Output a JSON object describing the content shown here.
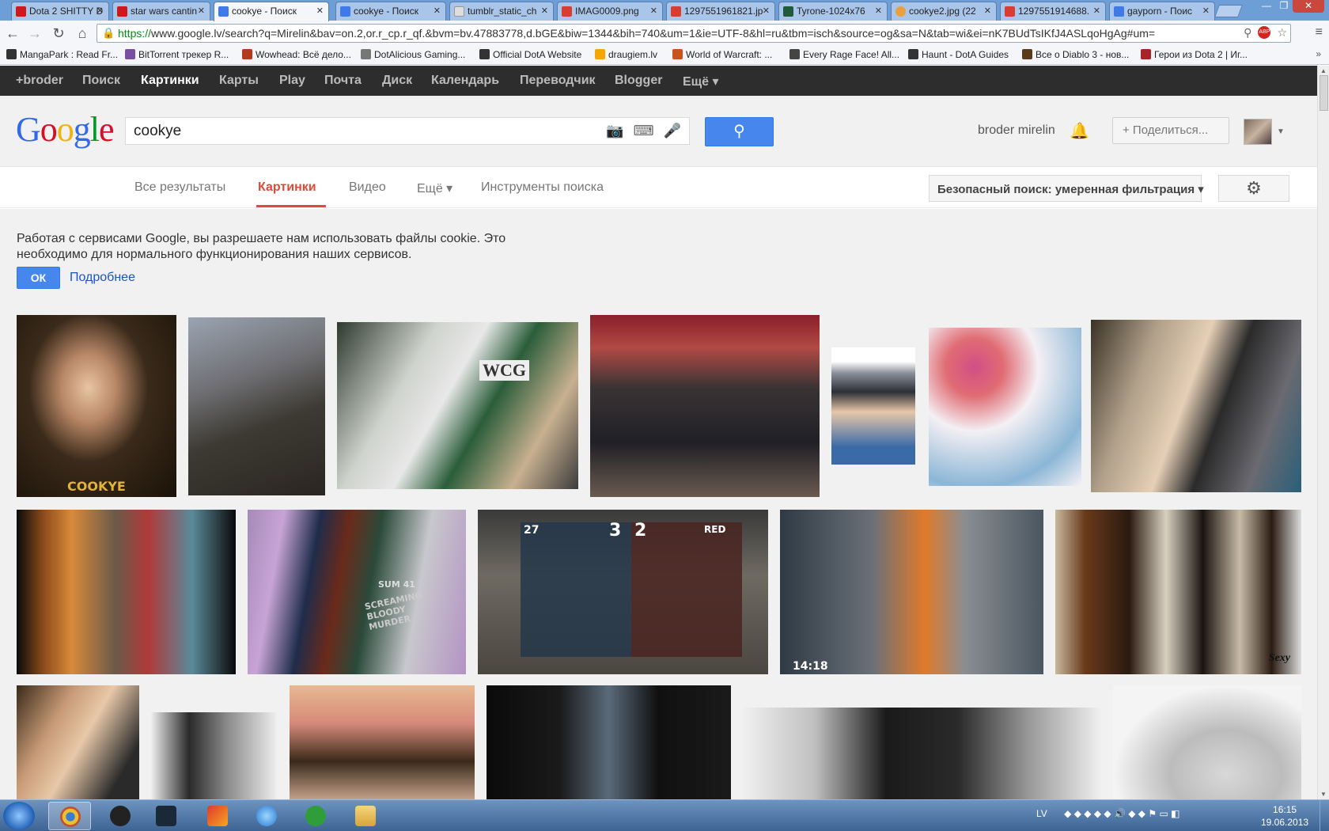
{
  "browser": {
    "tabs": [
      {
        "label": "Dota 2 SHITTY D",
        "color": "#cc181e"
      },
      {
        "label": "star wars cantin",
        "color": "#cc181e"
      },
      {
        "label": "cookye - Поиск",
        "color": "#3f7ae8"
      },
      {
        "label": "cookye - Поиск",
        "color": "#3f7ae8"
      },
      {
        "label": "tumblr_static_ch",
        "color": "#999999"
      },
      {
        "label": "IMAG0009.png",
        "color": "#d73d32"
      },
      {
        "label": "1297551961821.jp",
        "color": "#d73d32"
      },
      {
        "label": "Tyrone-1024x76",
        "color": "#1f5a3a"
      },
      {
        "label": "cookye2.jpg (22",
        "color": "#e8a13f"
      },
      {
        "label": "1297551914688.",
        "color": "#d73d32"
      },
      {
        "label": "gayporn - Поис",
        "color": "#3f7ae8"
      }
    ],
    "url_https": "https://",
    "url_rest": "www.google.lv/search?q=Mirelin&bav=on.2,or.r_cp.r_qf.&bvm=bv.47883778,d.bGE&biw=1344&bih=740&um=1&ie=UTF-8&hl=ru&tbm=isch&source=og&sa=N&tab=wi&ei=nK7BUdTsIKfJ4ASLqoHgAg#um=",
    "abp_label": "ABP",
    "bookmarks": [
      {
        "label": "MangaPark : Read Fr...",
        "color": "#333333"
      },
      {
        "label": "BitTorrent трекер R...",
        "color": "#7a4ea0"
      },
      {
        "label": "Wowhead: Всё дело...",
        "color": "#b33a1d"
      },
      {
        "label": "DotAlicious Gaming...",
        "color": "#777777"
      },
      {
        "label": "Official DotA Website",
        "color": "#333333"
      },
      {
        "label": "draugiem.lv",
        "color": "#f5a700"
      },
      {
        "label": "World of Warcraft: ...",
        "color": "#c9531e"
      },
      {
        "label": "Every Rage Face! All...",
        "color": "#444444"
      },
      {
        "label": "Haunt - DotA Guides",
        "color": "#333333"
      },
      {
        "label": "Все о Diablo 3 - нов...",
        "color": "#5a3a1a"
      },
      {
        "label": "Герои из Dota 2 | Иг...",
        "color": "#a5252a"
      }
    ]
  },
  "google": {
    "bar": [
      "+broder",
      "Поиск",
      "Картинки",
      "Карты",
      "Play",
      "Почта",
      "Диск",
      "Календарь",
      "Переводчик",
      "Blogger",
      "Ещё ▾"
    ],
    "logo": [
      "G",
      "o",
      "o",
      "g",
      "l",
      "e"
    ],
    "query": "cookye",
    "user": "broder mirelin",
    "share": "+ Поделиться...",
    "tabs": [
      "Все результаты",
      "Картинки",
      "Видео",
      "Ещё ▾",
      "Инструменты поиска"
    ],
    "safesearch": "Безопасный поиск: умеренная фильтрация ▾",
    "cookie_notice": "Работая с сервисами Google, вы разрешаете нам использовать файлы cookie. Это необходимо для нормального функционирования наших сервисов.",
    "ok": "ОК",
    "more": "Подробнее"
  },
  "images": {
    "captions": {
      "cookye": "COOKYE",
      "wcg": "WCG",
      "blue_score_left": "27",
      "blue_score_right": "3",
      "red_score_left": "2",
      "red_label": "RED",
      "timestamp": "14:18",
      "album": "SUM 41",
      "album_title": "SCREAMING BLOODY MURDER",
      "sexy": "Sexy"
    }
  },
  "taskbar": {
    "lang": "LV",
    "time": "16:15",
    "date": "19.06.2013"
  }
}
